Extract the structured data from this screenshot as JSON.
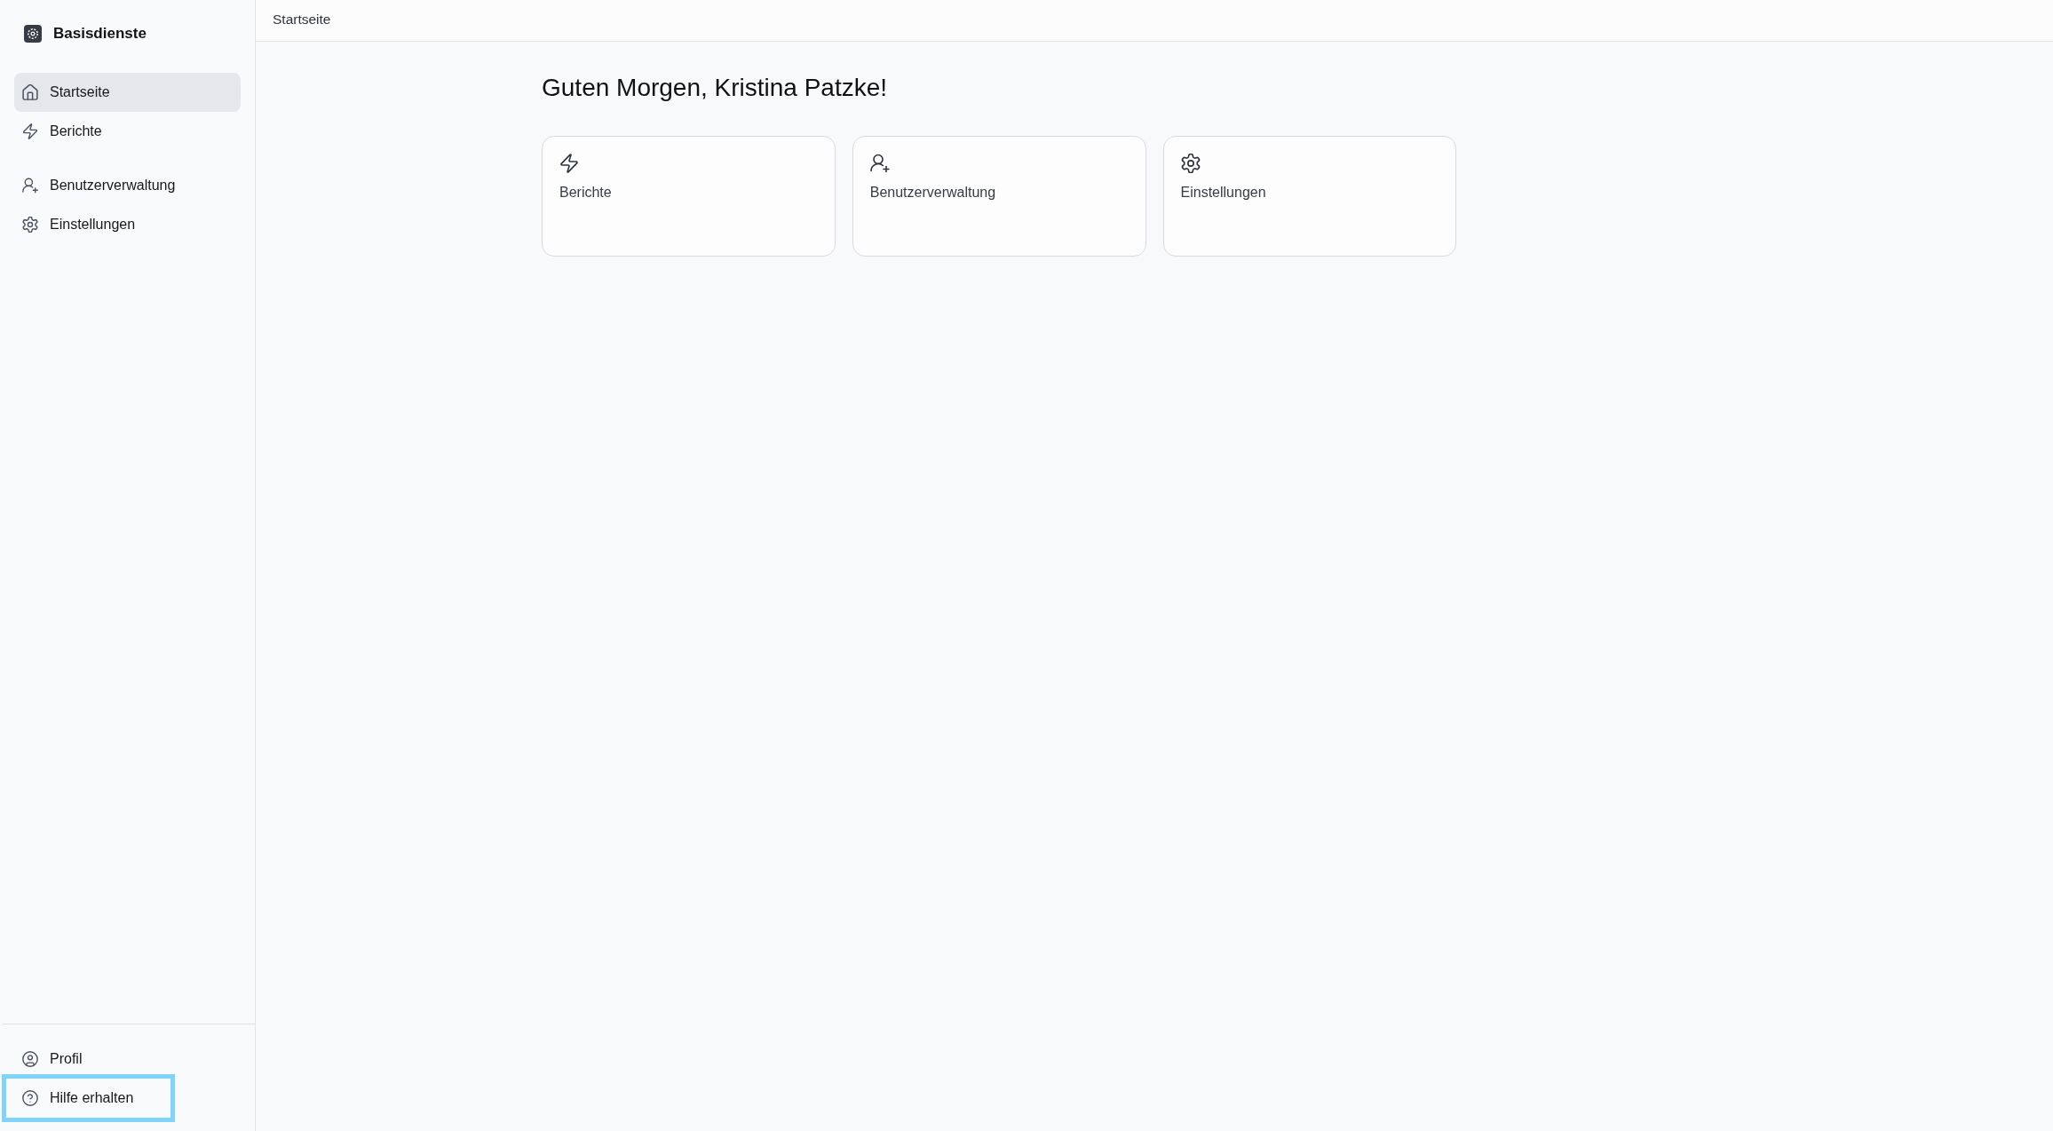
{
  "sidebar": {
    "app_title": "Basisdienste",
    "nav_groups": [
      {
        "items": [
          {
            "label": "Startseite",
            "kind": "home",
            "selected": true
          },
          {
            "label": "Berichte",
            "kind": "reports",
            "selected": false
          }
        ]
      },
      {
        "items": [
          {
            "label": "Benutzerverwaltung",
            "kind": "users",
            "selected": false
          },
          {
            "label": "Einstellungen",
            "kind": "settings",
            "selected": false
          }
        ]
      }
    ],
    "footer_items": [
      {
        "label": "Profil",
        "kind": "profile",
        "selected": false,
        "focused": false
      },
      {
        "label": "Hilfe erhalten",
        "kind": "help",
        "selected": false,
        "focused": true
      }
    ]
  },
  "header": {
    "breadcrumb": "Startseite"
  },
  "greeting": "Guten Morgen, Kristina Patzke!",
  "cards": [
    {
      "label": "Berichte",
      "kind": "reports"
    },
    {
      "label": "Benutzerverwaltung",
      "kind": "users"
    },
    {
      "label": "Einstellungen",
      "kind": "settings"
    }
  ]
}
